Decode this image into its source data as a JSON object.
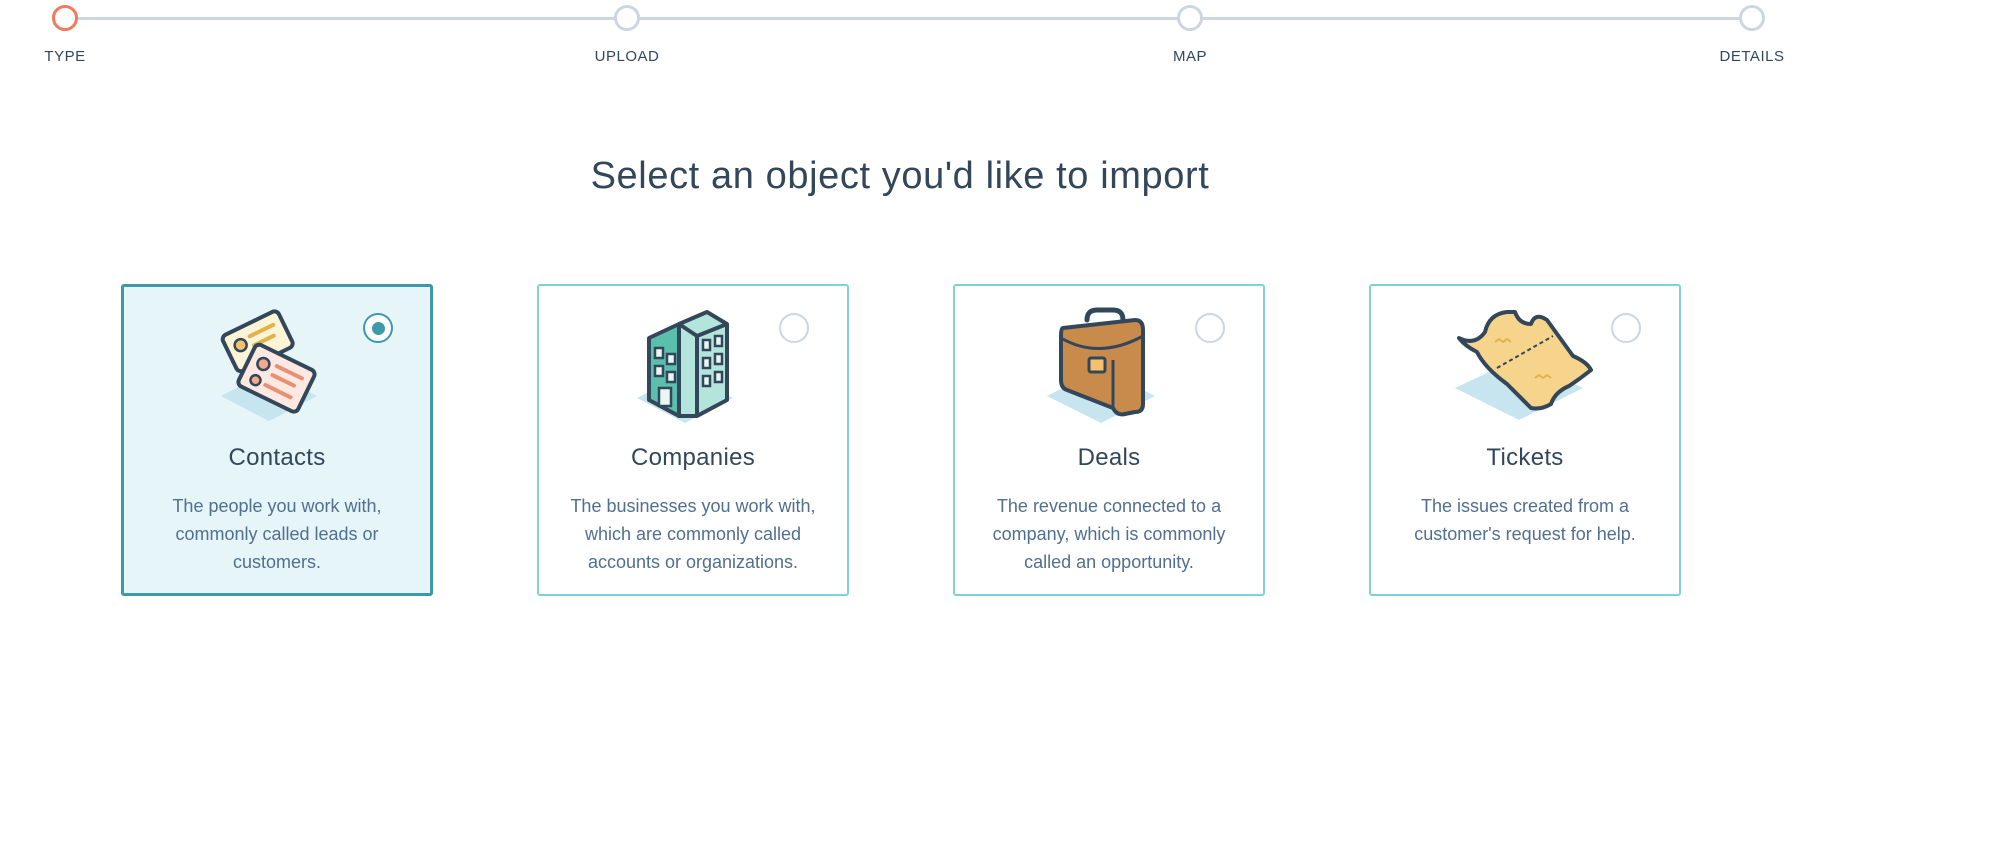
{
  "stepper": {
    "steps": [
      {
        "label": "TYPE",
        "state": "active"
      },
      {
        "label": "UPLOAD",
        "state": "inactive"
      },
      {
        "label": "MAP",
        "state": "inactive"
      },
      {
        "label": "DETAILS",
        "state": "inactive"
      }
    ],
    "active_color": "#f2795a",
    "inactive_color": "#cbd6e2"
  },
  "heading": {
    "title": "Select an object you'd like to import"
  },
  "cards": [
    {
      "title": "Contacts",
      "description": "The people you work with, commonly called leads or customers.",
      "icon": "contact-cards-icon",
      "selected": true
    },
    {
      "title": "Companies",
      "description": "The businesses you work with, which are commonly called accounts or organizations.",
      "icon": "building-icon",
      "selected": false
    },
    {
      "title": "Deals",
      "description": "The revenue connected to a company, which is commonly called an opportunity.",
      "icon": "briefcase-icon",
      "selected": false
    },
    {
      "title": "Tickets",
      "description": "The issues created from a customer's request for help.",
      "icon": "ticket-icon",
      "selected": false
    }
  ],
  "colors": {
    "accent": "#3e9aa8",
    "selected_background": "#e5f5f8",
    "card_border": "#7fd1de",
    "text": "#33475b",
    "muted_text": "#516f90"
  }
}
